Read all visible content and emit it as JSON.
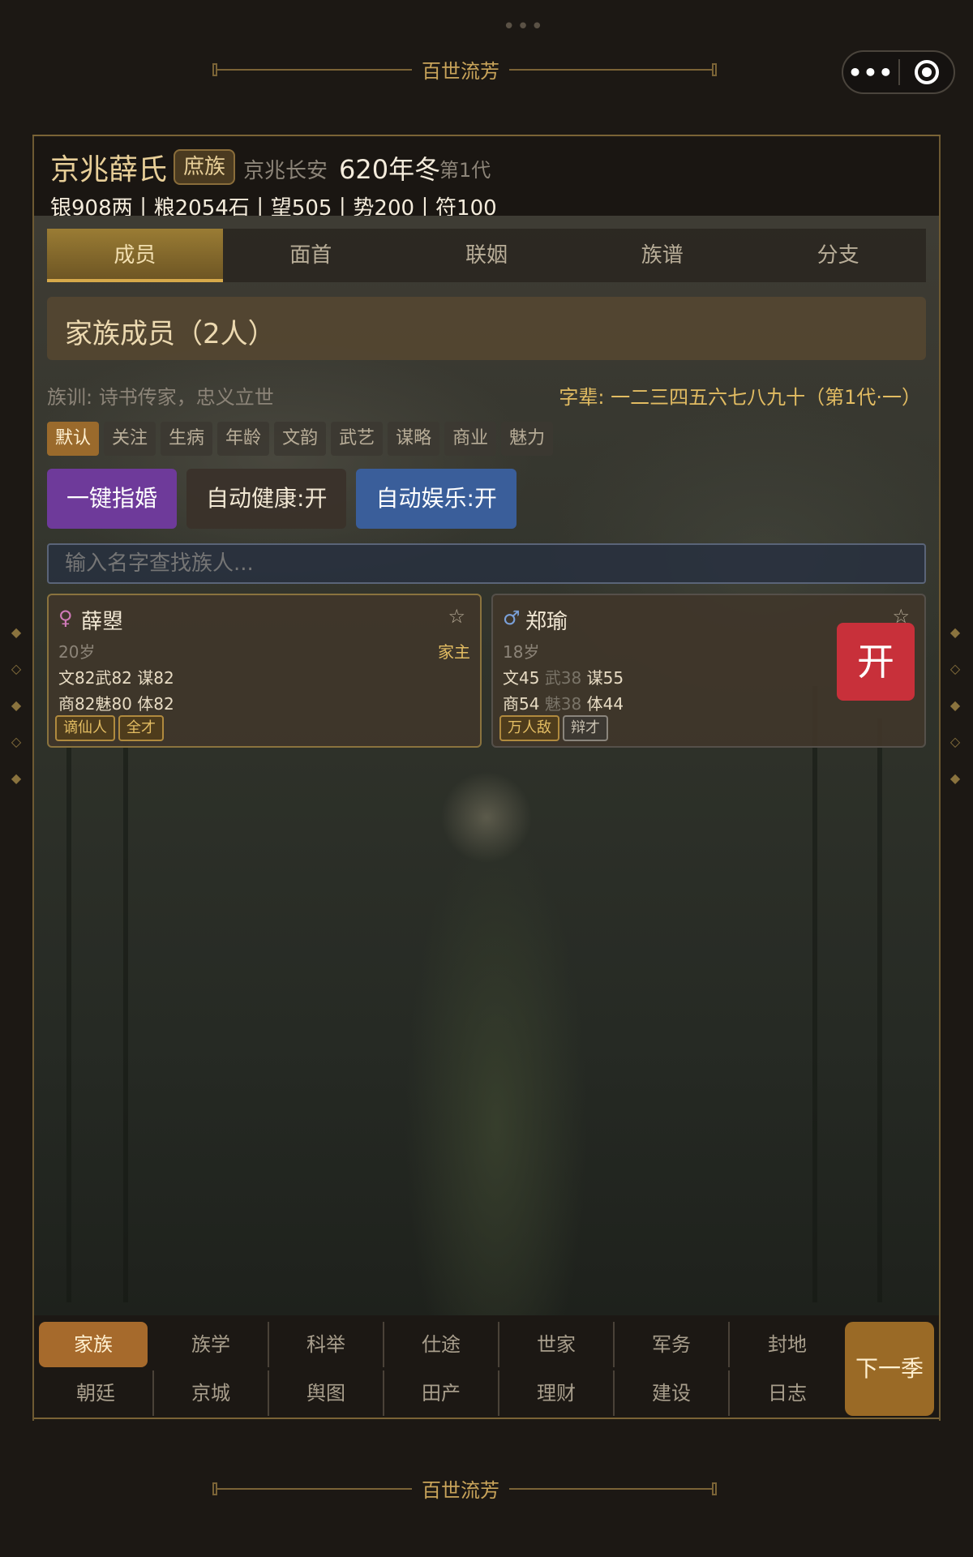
{
  "header": {
    "app_title": "百世流芳",
    "menu_dots": "•••",
    "capsule_more": "•••"
  },
  "clan": {
    "name": "京兆薛氏",
    "badge": "庶族",
    "location": "京兆长安",
    "year": "620年冬",
    "generation": "第1代",
    "resources": "银908两丨粮2054石丨望505丨势200丨符100"
  },
  "tabs": [
    {
      "label": "成员",
      "active": true
    },
    {
      "label": "面首"
    },
    {
      "label": "联姻"
    },
    {
      "label": "族谱"
    },
    {
      "label": "分支"
    }
  ],
  "panel": {
    "title": "家族成员（2人）",
    "motto": "族训: 诗书传家，忠义立世",
    "generation_names": "字辈: 一二三四五六七八九十（第1代·一）"
  },
  "filters": [
    "默认",
    "关注",
    "生病",
    "年龄",
    "文韵",
    "武艺",
    "谋略",
    "商业",
    "魅力"
  ],
  "actions": {
    "match": "一键指婚",
    "auto_health": "自动健康:开",
    "auto_fun": "自动娱乐:开"
  },
  "search": {
    "placeholder": "输入名字查找族人..."
  },
  "members": [
    {
      "gender_symbol": "♀",
      "name": "薛曌",
      "star": "☆",
      "age": "20岁",
      "role": "家主",
      "stats": {
        "wen": "文82",
        "wu": "武82",
        "mou": "谋82",
        "shang": "商82",
        "mei": "魅80",
        "ti": "体82"
      },
      "traits": [
        "谪仙人",
        "全才"
      ]
    },
    {
      "gender_symbol": "♂",
      "name": "郑瑜",
      "star": "☆",
      "age": "18岁",
      "role": "",
      "stats": {
        "wen": "文45",
        "wu": "武38",
        "mou": "谋55",
        "shang": "商54",
        "mei": "魅38",
        "ti": "体44"
      },
      "traits": [
        "万人敌",
        "辩才"
      ]
    }
  ],
  "open_button": "开",
  "bottom_nav": {
    "row1": [
      "家族",
      "族学",
      "科举",
      "仕途",
      "世家",
      "军务",
      "封地"
    ],
    "row2": [
      "朝廷",
      "京城",
      "舆图",
      "田产",
      "理财",
      "建设",
      "日志"
    ],
    "next_season": "下一季"
  },
  "colors": {
    "accent_gold": "#c9a45a",
    "active_tab": "#9a7c34",
    "purple_button": "#6e3a9a",
    "blue_button": "#3a5e9a",
    "open_button": "#c8303a"
  }
}
